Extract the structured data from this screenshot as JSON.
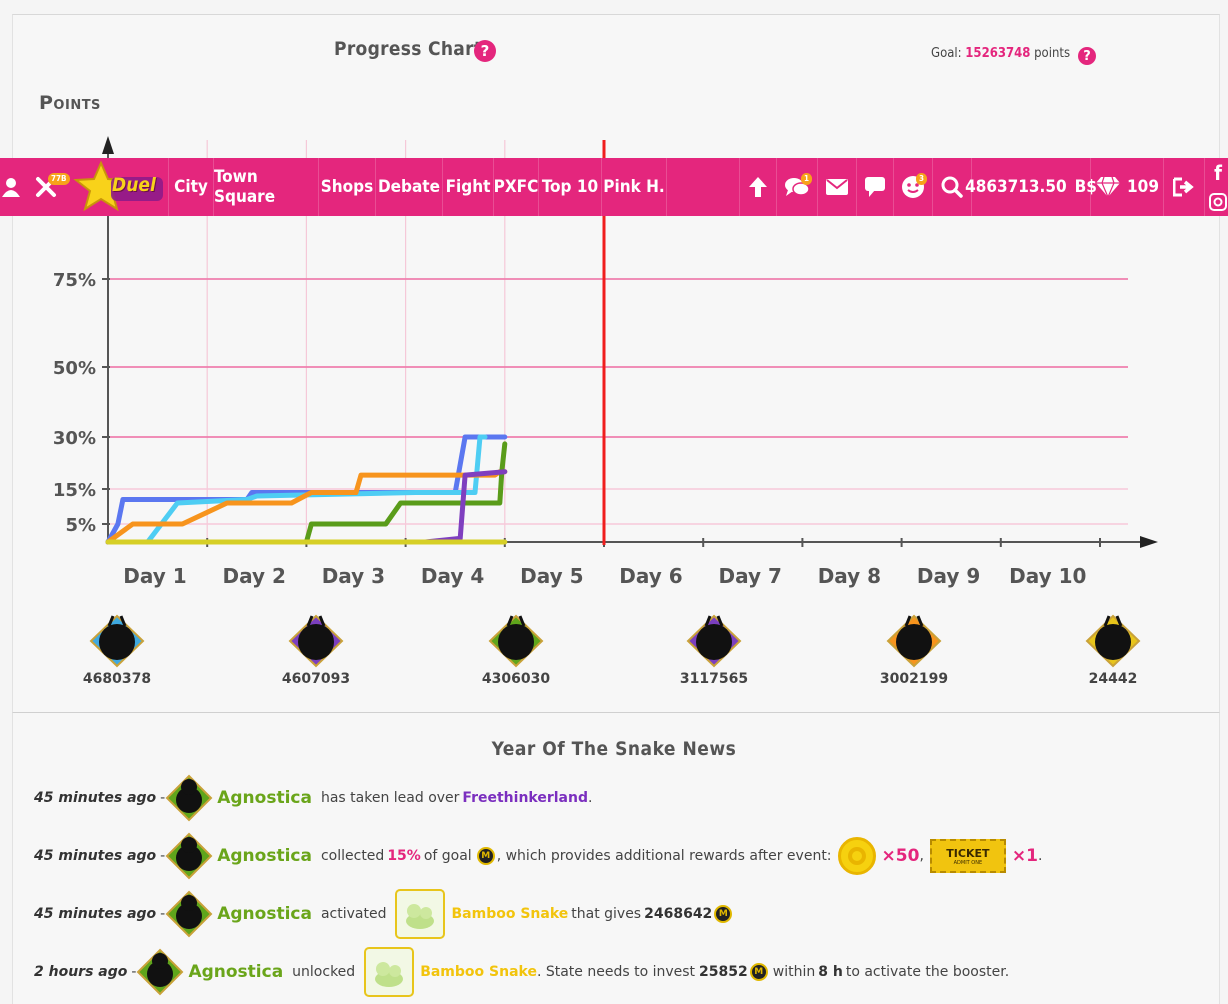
{
  "chart_panel": {
    "title": "Progress Chart",
    "help_icon": "question-icon",
    "goal_label": "Goal:",
    "goal_value": "15263748",
    "goal_unit": "points"
  },
  "chart_data": {
    "type": "line",
    "ylabel": "Points",
    "xlabel": "",
    "categories": [
      "Day 1",
      "Day 2",
      "Day 3",
      "Day 4",
      "Day 5",
      "Day 6",
      "Day 7",
      "Day 8",
      "Day 9",
      "Day 10"
    ],
    "y_tick_labels": [
      "5%",
      "15%",
      "30%",
      "50%",
      "75%"
    ],
    "y_ticks": [
      5,
      15,
      30,
      50,
      75
    ],
    "y_scale": "piecewise (5%,15%,30%,50%,75% ticks unevenly spaced)",
    "x_range": [
      0,
      10.5
    ],
    "current_marker_day": 5,
    "grid": true,
    "series": [
      {
        "color": "#5b77f0",
        "points": [
          [
            0,
            0
          ],
          [
            0.1,
            5
          ],
          [
            0.15,
            12
          ],
          [
            1.4,
            12
          ],
          [
            1.45,
            14
          ],
          [
            3.5,
            14
          ],
          [
            3.6,
            30
          ],
          [
            4.0,
            30
          ]
        ]
      },
      {
        "color": "#4ecdf3",
        "points": [
          [
            0.4,
            0
          ],
          [
            0.7,
            11
          ],
          [
            1.4,
            12
          ],
          [
            1.5,
            13
          ],
          [
            3.1,
            14
          ],
          [
            3.7,
            14
          ],
          [
            3.75,
            30
          ],
          [
            3.8,
            30
          ]
        ]
      },
      {
        "color": "#f7941d",
        "points": [
          [
            0,
            0
          ],
          [
            0.25,
            5
          ],
          [
            0.75,
            5
          ],
          [
            1.2,
            11
          ],
          [
            1.85,
            11
          ],
          [
            2.05,
            14
          ],
          [
            2.5,
            14
          ],
          [
            2.55,
            19
          ],
          [
            3.9,
            19
          ],
          [
            3.95,
            20
          ],
          [
            4.0,
            20
          ]
        ]
      },
      {
        "color": "#5a9c1a",
        "points": [
          [
            0,
            0
          ],
          [
            2.0,
            0
          ],
          [
            2.05,
            5
          ],
          [
            2.8,
            5
          ],
          [
            2.95,
            11
          ],
          [
            3.95,
            11
          ],
          [
            3.97,
            20
          ],
          [
            4.0,
            28
          ]
        ]
      },
      {
        "color": "#7f3fbf",
        "points": [
          [
            0,
            0
          ],
          [
            3.2,
            0
          ],
          [
            3.55,
            1
          ],
          [
            3.6,
            19
          ],
          [
            4.0,
            20
          ]
        ]
      },
      {
        "color": "#d6cf27",
        "points": [
          [
            0,
            0
          ],
          [
            4.0,
            0
          ]
        ]
      }
    ]
  },
  "nav": {
    "items": [
      "City",
      "Town Square",
      "Shops",
      "Debate",
      "Fight",
      "PXFC",
      "Top 10",
      "Pink H."
    ],
    "logo_text": "Duel",
    "close_badge": "77B",
    "chat_badge": "1",
    "emoji_badge": "3",
    "balance": "4863713.50",
    "currency": "B$",
    "gems": "109",
    "icons": [
      "user-icon",
      "close-icon",
      "duel-star-logo",
      "arrow-up-icon",
      "chat-icon",
      "mail-icon",
      "message-icon",
      "emoji-icon",
      "search-icon",
      "diamond-icon",
      "logout-icon",
      "facebook-icon",
      "instagram-icon"
    ]
  },
  "states": [
    {
      "icon": "deer-icon",
      "value": "4680378",
      "color": "#3fa9e0"
    },
    {
      "icon": "fish-icon",
      "value": "4607093",
      "color": "#7b3fbf"
    },
    {
      "icon": "frog-icon",
      "value": "4306030",
      "color": "#5fa51b"
    },
    {
      "icon": "owl-icon",
      "value": "3117565",
      "color": "#7b3fbf"
    },
    {
      "icon": "eagle-icon",
      "value": "3002199",
      "color": "#f7941d"
    },
    {
      "icon": "butterfly-icon",
      "value": "24442",
      "color": "#e8c51b"
    }
  ],
  "news": {
    "title": "Year Of The Snake News",
    "items": [
      {
        "time": "45 minutes ago",
        "dash": "-",
        "state": "Agnostica",
        "text1": "has taken lead over",
        "target": "Freethinkerland",
        "end": "."
      },
      {
        "time": "45 minutes ago",
        "dash": "-",
        "state": "Agnostica",
        "text1": "collected",
        "percent": "15%",
        "text2": "of goal",
        "text3": ", which provides additional rewards after event:",
        "reward1": "×50",
        "comma": ",",
        "ticket": "TICKET",
        "ticket_sub": "ADMIT ONE",
        "reward2": "×1",
        "end": "."
      },
      {
        "time": "45 minutes ago",
        "dash": "-",
        "state": "Agnostica",
        "text1": "activated",
        "booster": "Bamboo Snake",
        "text2": "that gives",
        "amount": "2468642"
      },
      {
        "time": "2 hours ago",
        "dash": "-",
        "state": "Agnostica",
        "text1": "unlocked",
        "booster": "Bamboo Snake",
        "text2": ". State needs to invest",
        "amount": "25852",
        "text3": "within",
        "duration": "8 h",
        "text4": "to activate the booster."
      }
    ]
  },
  "coin_glyph": "M"
}
